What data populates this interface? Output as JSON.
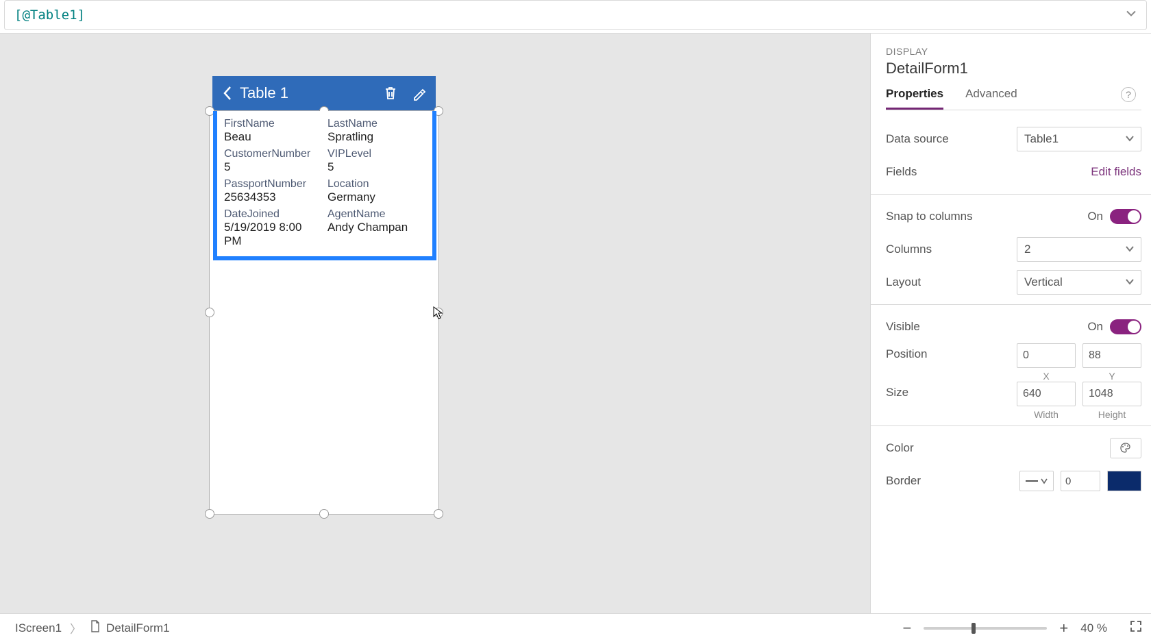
{
  "formulaBar": {
    "text": "[@Table1]"
  },
  "card": {
    "title": "Table 1",
    "fields": [
      {
        "label": "FirstName",
        "value": "Beau"
      },
      {
        "label": "LastName",
        "value": "Spratling"
      },
      {
        "label": "CustomerNumber",
        "value": "5"
      },
      {
        "label": "VIPLevel",
        "value": "5"
      },
      {
        "label": "PassportNumber",
        "value": "25634353"
      },
      {
        "label": "Location",
        "value": "Germany"
      },
      {
        "label": "DateJoined",
        "value": "5/19/2019 8:00 PM"
      },
      {
        "label": "AgentName",
        "value": "Andy Champan"
      }
    ]
  },
  "panel": {
    "sectionLabel": "DISPLAY",
    "title": "DetailForm1",
    "tabs": {
      "properties": "Properties",
      "advanced": "Advanced"
    },
    "props": {
      "dataSourceLabel": "Data source",
      "dataSourceValue": "Table1",
      "fieldsLabel": "Fields",
      "editFields": "Edit fields",
      "snapLabel": "Snap to columns",
      "snapState": "On",
      "columnsLabel": "Columns",
      "columnsValue": "2",
      "layoutLabel": "Layout",
      "layoutValue": "Vertical",
      "visibleLabel": "Visible",
      "visibleState": "On",
      "positionLabel": "Position",
      "posX": "0",
      "posY": "88",
      "xCap": "X",
      "yCap": "Y",
      "sizeLabel": "Size",
      "width": "640",
      "height": "1048",
      "widthCap": "Width",
      "heightCap": "Height",
      "colorLabel": "Color",
      "borderLabel": "Border",
      "borderWidth": "0"
    }
  },
  "status": {
    "crumb1": "IScreen1",
    "crumb2": "DetailForm1",
    "zoomText": "40 %"
  }
}
